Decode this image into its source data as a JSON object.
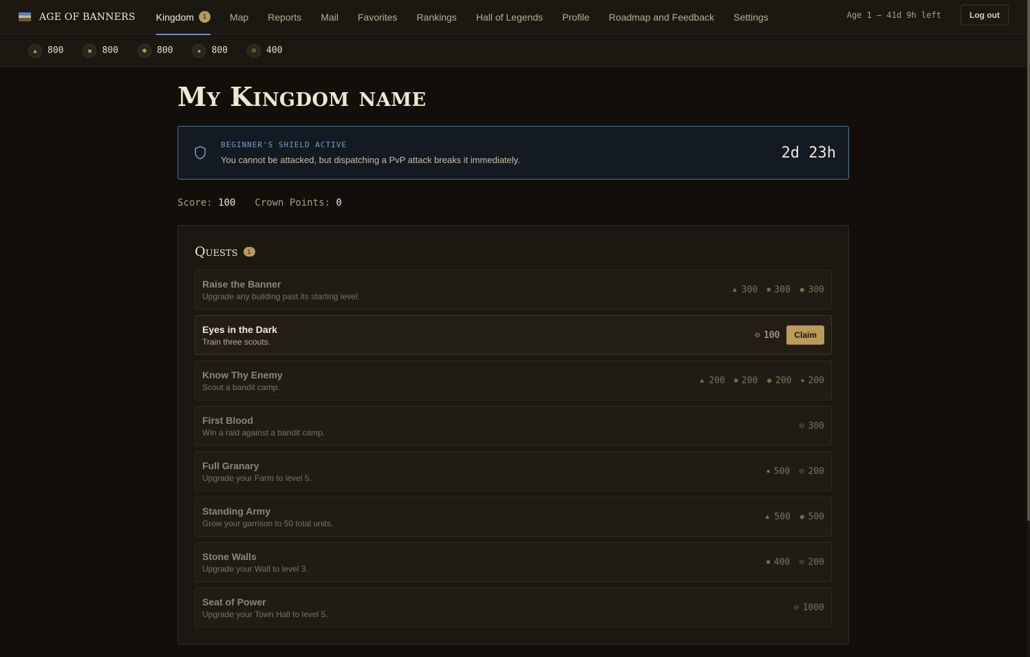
{
  "app": {
    "brand": "AGE OF BANNERS",
    "nav": [
      {
        "label": "Kingdom",
        "badge": "1"
      },
      {
        "label": "Map"
      },
      {
        "label": "Reports"
      },
      {
        "label": "Mail"
      },
      {
        "label": "Favorites"
      },
      {
        "label": "Rankings"
      },
      {
        "label": "Hall of Legends"
      },
      {
        "label": "Profile"
      },
      {
        "label": "Roadmap and Feedback"
      },
      {
        "label": "Settings"
      }
    ],
    "age_info": "Age 1 — 41d 9h left",
    "logout_label": "Log out"
  },
  "resources": [
    {
      "icon": "triangle-icon",
      "value": "800"
    },
    {
      "icon": "square-icon",
      "value": "800"
    },
    {
      "icon": "diamond-icon",
      "value": "800"
    },
    {
      "icon": "circle-icon",
      "value": "800"
    },
    {
      "icon": "coin-icon",
      "value": "400"
    }
  ],
  "kingdom": {
    "name": "My Kingdom name",
    "shield": {
      "title": "BEGINNER'S SHIELD ACTIVE",
      "description": "You cannot be attacked, but dispatching a PvP attack breaks it immediately.",
      "time_left": "2d 23h"
    },
    "score_label": "Score:",
    "score": "100",
    "crown_label": "Crown Points:",
    "crown_points": "0"
  },
  "quests": {
    "title": "Quests",
    "badge": "1",
    "claim_label": "Claim",
    "items": [
      {
        "name": "Raise the Banner",
        "desc": "Upgrade any building past its starting level.",
        "active": false,
        "rewards": [
          {
            "icon": "triangle-icon",
            "value": "300"
          },
          {
            "icon": "square-icon",
            "value": "300"
          },
          {
            "icon": "diamond-icon",
            "value": "300"
          }
        ]
      },
      {
        "name": "Eyes in the Dark",
        "desc": "Train three scouts.",
        "active": true,
        "rewards": [
          {
            "icon": "coin-icon",
            "value": "100"
          }
        ]
      },
      {
        "name": "Know Thy Enemy",
        "desc": "Scout a bandit camp.",
        "active": false,
        "rewards": [
          {
            "icon": "triangle-icon",
            "value": "200"
          },
          {
            "icon": "square-icon",
            "value": "200"
          },
          {
            "icon": "diamond-icon",
            "value": "200"
          },
          {
            "icon": "circle-icon",
            "value": "200"
          }
        ]
      },
      {
        "name": "First Blood",
        "desc": "Win a raid against a bandit camp.",
        "active": false,
        "rewards": [
          {
            "icon": "coin-icon",
            "value": "300"
          }
        ]
      },
      {
        "name": "Full Granary",
        "desc": "Upgrade your Farm to level 5.",
        "active": false,
        "rewards": [
          {
            "icon": "circle-icon",
            "value": "500"
          },
          {
            "icon": "coin-icon",
            "value": "200"
          }
        ]
      },
      {
        "name": "Standing Army",
        "desc": "Grow your garrison to 50 total units.",
        "active": false,
        "rewards": [
          {
            "icon": "triangle-icon",
            "value": "500"
          },
          {
            "icon": "diamond-icon",
            "value": "500"
          }
        ]
      },
      {
        "name": "Stone Walls",
        "desc": "Upgrade your Wall to level 3.",
        "active": false,
        "rewards": [
          {
            "icon": "square-icon",
            "value": "400"
          },
          {
            "icon": "coin-icon",
            "value": "200"
          }
        ]
      },
      {
        "name": "Seat of Power",
        "desc": "Upgrade your Town Hall to level 5.",
        "active": false,
        "rewards": [
          {
            "icon": "coin-icon",
            "value": "1000"
          }
        ]
      }
    ]
  },
  "colors": {
    "background": "#120f0b",
    "panel": "#1b1812",
    "accent_gold": "#b89a5a",
    "accent_blue": "#6e8fc4"
  }
}
